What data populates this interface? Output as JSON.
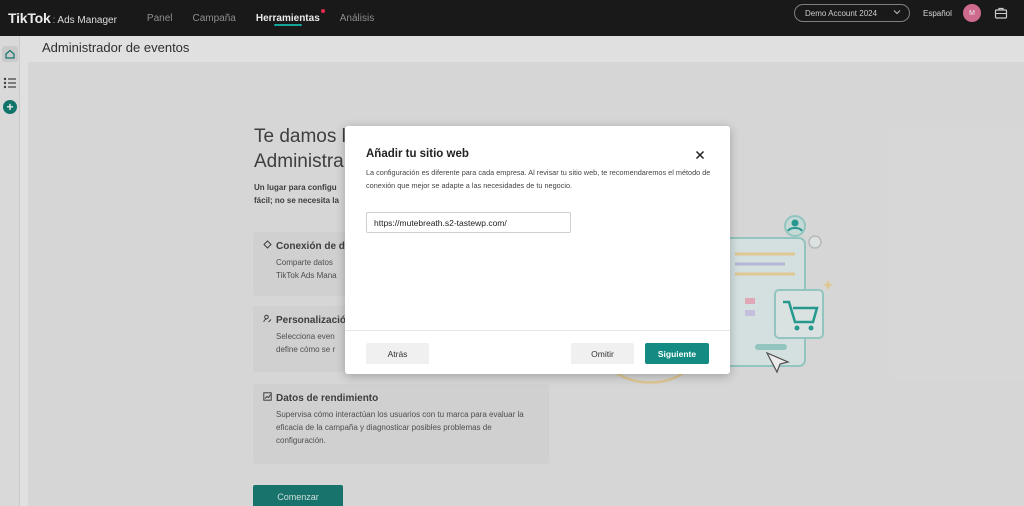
{
  "header": {
    "logo": "TikTok",
    "logo_separator": ":",
    "logo_sub": "Ads Manager",
    "nav": [
      {
        "label": "Panel",
        "active": false
      },
      {
        "label": "Campaña",
        "active": false
      },
      {
        "label": "Herramientas",
        "active": true,
        "dot": true
      },
      {
        "label": "Análisis",
        "active": false
      }
    ],
    "account": "Demo Account 2024",
    "language": "Español",
    "avatar_initial": "M",
    "icons": [
      "chevron-down-icon",
      "briefcase-icon"
    ]
  },
  "sidebar": {
    "icons": [
      "home-icon",
      "list-icon",
      "plus-icon"
    ]
  },
  "page": {
    "title": "Administrador de eventos"
  },
  "background": {
    "heading": "Te damos l\nAdministra",
    "intro": "Un lugar para configu\nfácil; no se necesita la",
    "cards": [
      {
        "title": "Conexión de d",
        "desc": "Comparte datos\nTikTok Ads Mana",
        "icon": "connect-icon"
      },
      {
        "title": "Personalizació",
        "desc": "Selecciona even\ndefine cómo se r",
        "icon": "user-edit-icon"
      },
      {
        "title": "Datos de rendimiento",
        "desc": "Supervisa cómo interactúan los usuarios con tu marca para evaluar la eficacia de la campaña y diagnosticar posibles problemas de configuración.",
        "icon": "chart-icon"
      }
    ],
    "start_button": "Comenzar"
  },
  "modal": {
    "title": "Añadir tu sitio web",
    "description": "La configuración es diferente para cada empresa. Al revisar tu sitio web, te recomendaremos el método de conexión que mejor se adapte a las necesidades de tu negocio.",
    "url_value": "https://mutebreath.s2-tastewp.com/",
    "back_label": "Atrás",
    "skip_label": "Omitir",
    "next_label": "Siguiente"
  },
  "colors": {
    "accent": "#138b83",
    "topbar": "#1c1c1c",
    "nav_active_underline": "#18b3a6",
    "avatar": "#e0749a"
  }
}
